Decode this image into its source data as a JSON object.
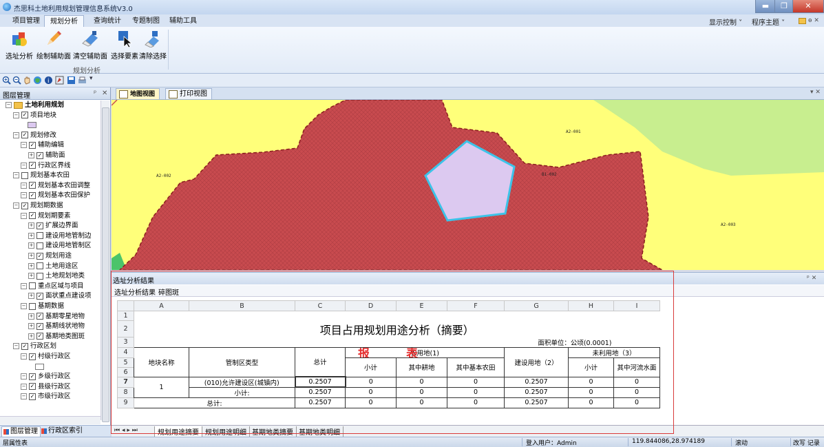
{
  "app": {
    "title": "杰思科土地利用规划管理信息系统V3.0"
  },
  "menu": {
    "tabs": [
      "项目管理",
      "规划分析",
      "查询统计",
      "专题制图",
      "辅助工具"
    ],
    "active": "规划分析"
  },
  "right_controls": {
    "display": "显示控制",
    "theme": "程序主题"
  },
  "ribbon": {
    "buttons": [
      "选址分析",
      "绘制辅助面",
      "清空辅助面",
      "选择要素",
      "清除选择"
    ],
    "group_label": "规划分析"
  },
  "layer_panel": {
    "title": "图层管理",
    "tree": [
      {
        "label": "土地利用规划",
        "level": 0,
        "checked": false,
        "bold": true
      },
      {
        "label": "项目地块",
        "level": 1,
        "checked": true
      },
      {
        "label": "",
        "level": 2,
        "swatch": true
      },
      {
        "label": "规划修改",
        "level": 1,
        "checked": true
      },
      {
        "label": "辅助编辑",
        "level": 2,
        "checked": true
      },
      {
        "label": "辅助面",
        "level": 3,
        "checked": true
      },
      {
        "label": "行政区界线",
        "level": 2,
        "checked": true
      },
      {
        "label": "规划基本农田",
        "level": 1,
        "checked": false
      },
      {
        "label": "规划基本农田调整",
        "level": 2,
        "checked": true
      },
      {
        "label": "规划基本农田保护",
        "level": 2,
        "checked": true
      },
      {
        "label": "规划期数据",
        "level": 1,
        "checked": true
      },
      {
        "label": "规划期要素",
        "level": 2,
        "checked": true
      },
      {
        "label": "扩展边界面",
        "level": 3,
        "checked": true
      },
      {
        "label": "建设用地管制边",
        "level": 3,
        "checked": false
      },
      {
        "label": "建设用地管制区",
        "level": 3,
        "checked": false
      },
      {
        "label": "规划用途",
        "level": 3,
        "checked": true
      },
      {
        "label": "土地用途区",
        "level": 3,
        "checked": false
      },
      {
        "label": "土地规划地类",
        "level": 3,
        "checked": false
      },
      {
        "label": "重点区域与项目",
        "level": 2,
        "checked": false
      },
      {
        "label": "面状重点建设项",
        "level": 3,
        "checked": true
      },
      {
        "label": "基期数据",
        "level": 2,
        "checked": false
      },
      {
        "label": "基期零星地物",
        "level": 3,
        "checked": true
      },
      {
        "label": "基期线状地物",
        "level": 3,
        "checked": true
      },
      {
        "label": "基期地类图斑",
        "level": 3,
        "checked": true
      },
      {
        "label": "行政区划",
        "level": 1,
        "checked": true
      },
      {
        "label": "村级行政区",
        "level": 2,
        "checked": true
      },
      {
        "label": "",
        "level": 3,
        "swatch": true
      },
      {
        "label": "乡级行政区",
        "level": 2,
        "checked": true
      },
      {
        "label": "县级行政区",
        "level": 2,
        "checked": true
      },
      {
        "label": "市级行政区",
        "level": 2,
        "checked": true
      }
    ],
    "bottom_tabs": [
      "图层管理",
      "行政区索引"
    ]
  },
  "doc_tabs": [
    "地图视图",
    "打印视图"
  ],
  "map_labels": [
    "A2-001",
    "A2-002",
    "B1-002",
    "A2-003"
  ],
  "result_panel": {
    "title": "选址分析结果",
    "subtabs": [
      "选址分析结果",
      "碎图斑"
    ],
    "columns": [
      "A",
      "B",
      "C",
      "D",
      "E",
      "F",
      "G",
      "H",
      "I"
    ],
    "rows": [
      "1",
      "2",
      "3",
      "4",
      "5",
      "6",
      "7",
      "8",
      "9"
    ],
    "report_title": "项目占用规划用途分析（摘要）",
    "unit": "面积单位：公顷(0.0001)",
    "watermark": [
      "报",
      "表"
    ],
    "headers": {
      "parcel": "地块名称",
      "zone": "管制区类型",
      "total": "总计",
      "agri": "农用地(1)",
      "subtotal": "小计",
      "cultivated": "其中耕地",
      "basic_farmland": "其中基本农田",
      "construction": "建设用地（2）",
      "unused": "未利用地（3）",
      "unused_subtotal": "小计",
      "river": "其中河流水面"
    },
    "data": [
      {
        "parcel": "1",
        "zone": "(010)允许建设区(城镇内)",
        "vals": [
          "0.2507",
          "0",
          "0",
          "0",
          "0.2507",
          "0",
          "0"
        ]
      },
      {
        "parcel": "",
        "zone": "小计:",
        "vals": [
          "0.2507",
          "0",
          "0",
          "0",
          "0.2507",
          "0",
          "0"
        ]
      },
      {
        "parcel": "",
        "zone": "总计:",
        "vals": [
          "0.2507",
          "0",
          "0",
          "0",
          "0.2507",
          "0",
          "0"
        ]
      }
    ],
    "sheet_tabs": [
      "规划用途摘要",
      "规划用途明细",
      "基期地类摘要",
      "基期地类明细"
    ]
  },
  "status": {
    "left": "层属性表",
    "user": "登入用户：Admin",
    "coords": "119.844086,28.974189",
    "scroll": "滚动",
    "right": "改写 记录"
  },
  "colors": {
    "map_bg": "#ffff7a",
    "red_area": "#c84b4f",
    "green": "#c8ee8f",
    "pentagon": "#dcc9f0",
    "pentagon_border": "#3cc3e8",
    "highlight_border": "#d93a3a"
  }
}
